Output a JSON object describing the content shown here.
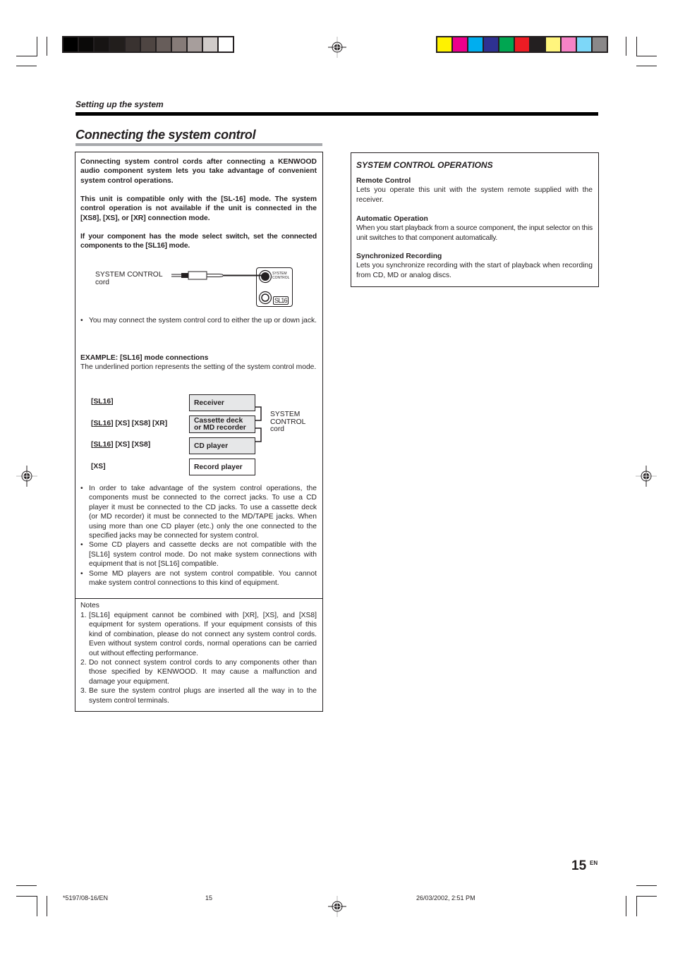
{
  "print_marks": {
    "grayscale_bar": [
      "#000000",
      "#0b0a09",
      "#171413",
      "#221e1c",
      "#393230",
      "#4e4542",
      "#675d5a",
      "#867b78",
      "#a79e9c",
      "#d0cbc9",
      "#ffffff"
    ],
    "color_bar": [
      "#fff200",
      "#ec008c",
      "#00aeef",
      "#2e3192",
      "#00a651",
      "#ed1c24",
      "#231f20",
      "#fff57d",
      "#f683c6",
      "#7dd7f8",
      "#8a8889"
    ]
  },
  "header": {
    "section": "Setting up the system",
    "title": "Connecting the system control"
  },
  "left_box": {
    "intro_1": "Connecting system control cords after connecting a KENWOOD audio component system lets you take advantage of convenient system control operations.",
    "intro_2": "This unit is compatible only with the [SL-16] mode. The system control operation is not available if the unit is connected in the [XS8], [XS], or [XR] connection mode.",
    "intro_3": "If your component has the mode select switch, set the connected components to the [SL16] mode.",
    "cord_figure": {
      "label_line1": "SYSTEM CONTROL",
      "label_line2": "cord",
      "jack_label_line1": "SYSTEM",
      "jack_label_line2": "CONTROL",
      "mode_badge": "SL16"
    },
    "jack_note": "You may connect the system control cord to either the up or down jack.",
    "example_heading": "EXAMPLE: [SL16] mode connections",
    "example_desc": "The underlined portion represents the setting of the system control mode.",
    "example_rows": [
      {
        "mode_prefix": "[",
        "mode_underlined": "SL16",
        "mode_suffix": "]",
        "component": "Receiver"
      },
      {
        "mode_prefix": "[",
        "mode_underlined": "SL16",
        "mode_suffix": "] [XS] [XS8] [XR]",
        "component_line1": "Cassette deck",
        "component_line2": "or MD recorder"
      },
      {
        "mode_prefix": "[",
        "mode_underlined": "SL16",
        "mode_suffix": "] [XS] [XS8]",
        "component": "CD player"
      },
      {
        "mode_prefix": "[XS]",
        "mode_underlined": "",
        "mode_suffix": "",
        "component": "Record player"
      }
    ],
    "cord_label": {
      "line1": "SYSTEM",
      "line2": "CONTROL",
      "line3": "cord"
    },
    "bullets": [
      "In order to take advantage of the system control operations, the components must be connected to the correct jacks. To use a CD player it must be connected to the CD jacks. To use a cassette deck (or MD recorder) it must be connected to the MD/TAPE jacks. When using more than one CD player (etc.) only the one connected to the specified jacks may be connected for system control.",
      "Some CD players and cassette decks are not compatible with the [SL16] system control mode. Do not make system connections with equipment that is not [SL16] compatible.",
      "Some MD players are not system control compatible. You cannot make system control connections to this kind of equipment."
    ],
    "notes_heading": "Notes",
    "notes": [
      {
        "num": "1.",
        "text": "[SL16] equipment cannot be combined with [XR], [XS], and [XS8] equipment for system operations. If your equipment consists of this kind of combination, please do not connect any system control cords. Even without system control cords, normal operations can be carried out without effecting performance."
      },
      {
        "num": "2.",
        "text": "Do not connect system control cords to any components other than those specified by KENWOOD. It may cause a malfunction and damage your equipment."
      },
      {
        "num": "3.",
        "text": "Be sure the system control plugs are inserted all the way in to the system control terminals."
      }
    ]
  },
  "right_box": {
    "heading": "SYSTEM CONTROL OPERATIONS",
    "items": [
      {
        "title": "Remote Control",
        "text": "Lets you operate this unit with the system remote supplied with the receiver."
      },
      {
        "title": "Automatic Operation",
        "text": "When you start playback from a source component, the input selector on this unit switches to that component automatically."
      },
      {
        "title": "Synchronized Recording",
        "text": "Lets you synchronize recording with the start of playback when recording from CD, MD or analog discs."
      }
    ]
  },
  "footer": {
    "page_number": "15",
    "lang": "EN",
    "slug_code": "*5197/08-16/EN",
    "slug_page": "15",
    "slug_date": "26/03/2002, 2:51 PM"
  }
}
